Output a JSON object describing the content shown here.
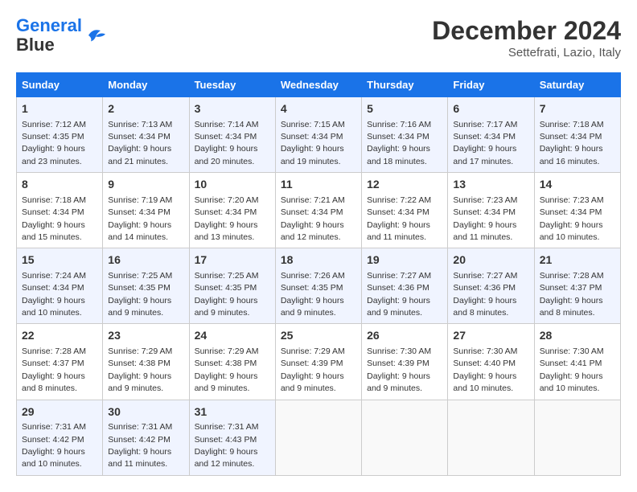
{
  "logo": {
    "line1": "General",
    "line2": "Blue"
  },
  "title": "December 2024",
  "location": "Settefrati, Lazio, Italy",
  "days_of_week": [
    "Sunday",
    "Monday",
    "Tuesday",
    "Wednesday",
    "Thursday",
    "Friday",
    "Saturday"
  ],
  "weeks": [
    [
      {
        "day": "1",
        "sunrise": "7:12 AM",
        "sunset": "4:35 PM",
        "daylight": "9 hours and 23 minutes."
      },
      {
        "day": "2",
        "sunrise": "7:13 AM",
        "sunset": "4:34 PM",
        "daylight": "9 hours and 21 minutes."
      },
      {
        "day": "3",
        "sunrise": "7:14 AM",
        "sunset": "4:34 PM",
        "daylight": "9 hours and 20 minutes."
      },
      {
        "day": "4",
        "sunrise": "7:15 AM",
        "sunset": "4:34 PM",
        "daylight": "9 hours and 19 minutes."
      },
      {
        "day": "5",
        "sunrise": "7:16 AM",
        "sunset": "4:34 PM",
        "daylight": "9 hours and 18 minutes."
      },
      {
        "day": "6",
        "sunrise": "7:17 AM",
        "sunset": "4:34 PM",
        "daylight": "9 hours and 17 minutes."
      },
      {
        "day": "7",
        "sunrise": "7:18 AM",
        "sunset": "4:34 PM",
        "daylight": "9 hours and 16 minutes."
      }
    ],
    [
      {
        "day": "8",
        "sunrise": "7:18 AM",
        "sunset": "4:34 PM",
        "daylight": "9 hours and 15 minutes."
      },
      {
        "day": "9",
        "sunrise": "7:19 AM",
        "sunset": "4:34 PM",
        "daylight": "9 hours and 14 minutes."
      },
      {
        "day": "10",
        "sunrise": "7:20 AM",
        "sunset": "4:34 PM",
        "daylight": "9 hours and 13 minutes."
      },
      {
        "day": "11",
        "sunrise": "7:21 AM",
        "sunset": "4:34 PM",
        "daylight": "9 hours and 12 minutes."
      },
      {
        "day": "12",
        "sunrise": "7:22 AM",
        "sunset": "4:34 PM",
        "daylight": "9 hours and 11 minutes."
      },
      {
        "day": "13",
        "sunrise": "7:23 AM",
        "sunset": "4:34 PM",
        "daylight": "9 hours and 11 minutes."
      },
      {
        "day": "14",
        "sunrise": "7:23 AM",
        "sunset": "4:34 PM",
        "daylight": "9 hours and 10 minutes."
      }
    ],
    [
      {
        "day": "15",
        "sunrise": "7:24 AM",
        "sunset": "4:34 PM",
        "daylight": "9 hours and 10 minutes."
      },
      {
        "day": "16",
        "sunrise": "7:25 AM",
        "sunset": "4:35 PM",
        "daylight": "9 hours and 9 minutes."
      },
      {
        "day": "17",
        "sunrise": "7:25 AM",
        "sunset": "4:35 PM",
        "daylight": "9 hours and 9 minutes."
      },
      {
        "day": "18",
        "sunrise": "7:26 AM",
        "sunset": "4:35 PM",
        "daylight": "9 hours and 9 minutes."
      },
      {
        "day": "19",
        "sunrise": "7:27 AM",
        "sunset": "4:36 PM",
        "daylight": "9 hours and 9 minutes."
      },
      {
        "day": "20",
        "sunrise": "7:27 AM",
        "sunset": "4:36 PM",
        "daylight": "9 hours and 8 minutes."
      },
      {
        "day": "21",
        "sunrise": "7:28 AM",
        "sunset": "4:37 PM",
        "daylight": "9 hours and 8 minutes."
      }
    ],
    [
      {
        "day": "22",
        "sunrise": "7:28 AM",
        "sunset": "4:37 PM",
        "daylight": "9 hours and 8 minutes."
      },
      {
        "day": "23",
        "sunrise": "7:29 AM",
        "sunset": "4:38 PM",
        "daylight": "9 hours and 9 minutes."
      },
      {
        "day": "24",
        "sunrise": "7:29 AM",
        "sunset": "4:38 PM",
        "daylight": "9 hours and 9 minutes."
      },
      {
        "day": "25",
        "sunrise": "7:29 AM",
        "sunset": "4:39 PM",
        "daylight": "9 hours and 9 minutes."
      },
      {
        "day": "26",
        "sunrise": "7:30 AM",
        "sunset": "4:39 PM",
        "daylight": "9 hours and 9 minutes."
      },
      {
        "day": "27",
        "sunrise": "7:30 AM",
        "sunset": "4:40 PM",
        "daylight": "9 hours and 10 minutes."
      },
      {
        "day": "28",
        "sunrise": "7:30 AM",
        "sunset": "4:41 PM",
        "daylight": "9 hours and 10 minutes."
      }
    ],
    [
      {
        "day": "29",
        "sunrise": "7:31 AM",
        "sunset": "4:42 PM",
        "daylight": "9 hours and 10 minutes."
      },
      {
        "day": "30",
        "sunrise": "7:31 AM",
        "sunset": "4:42 PM",
        "daylight": "9 hours and 11 minutes."
      },
      {
        "day": "31",
        "sunrise": "7:31 AM",
        "sunset": "4:43 PM",
        "daylight": "9 hours and 12 minutes."
      },
      null,
      null,
      null,
      null
    ]
  ],
  "labels": {
    "sunrise": "Sunrise:",
    "sunset": "Sunset:",
    "daylight": "Daylight:"
  }
}
